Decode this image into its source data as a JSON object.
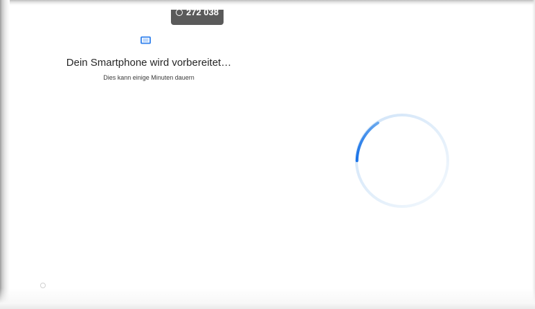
{
  "top_badge": {
    "number": "272 038",
    "icon": "circle-icon"
  },
  "setup": {
    "device_icon": "phone-landscape-icon",
    "title": "Dein Smartphone wird vorbereitet…",
    "subtitle": "Dies kann einige Minuten dauern"
  },
  "loader": {
    "accent_color": "#1a73e8",
    "track_color": "#d6e8fa",
    "icon": "loading-spinner-icon"
  },
  "footer": {
    "indicator_icon": "status-dot-icon"
  }
}
